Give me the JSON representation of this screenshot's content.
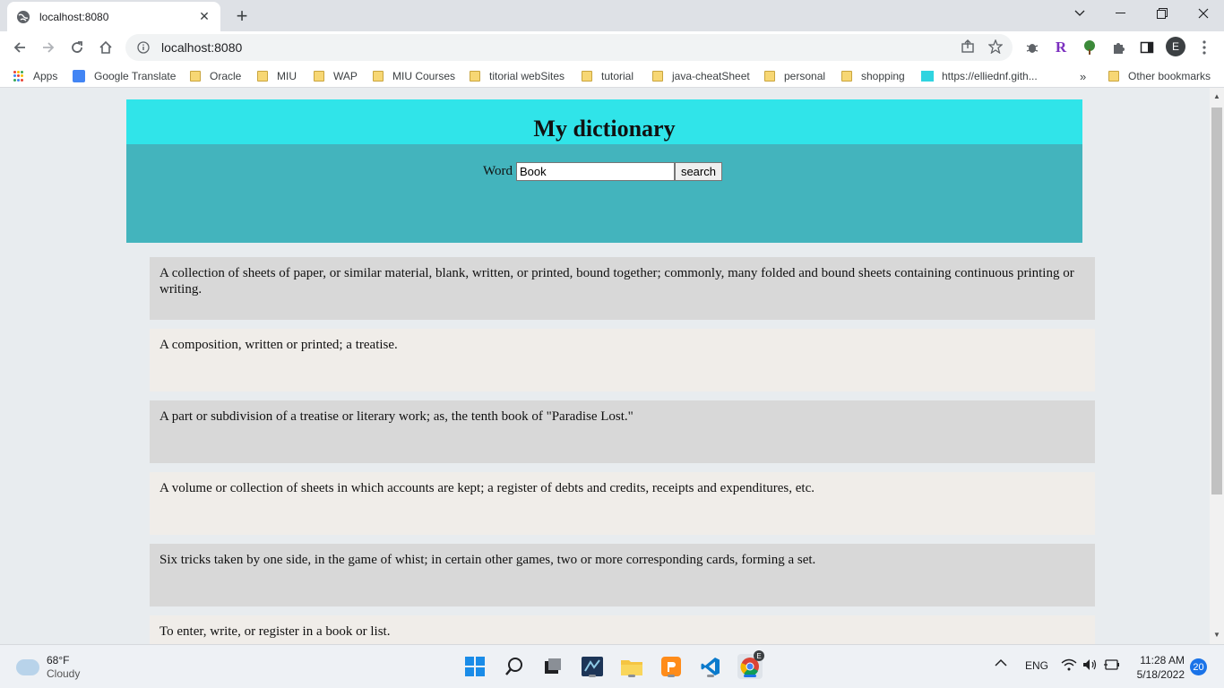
{
  "browser": {
    "tab_title": "localhost:8080",
    "address": "localhost:8080",
    "profile_initial": "E",
    "window_controls": [
      "chevron-down",
      "minimize",
      "restore",
      "close"
    ]
  },
  "bookmarks": [
    {
      "label": "Apps",
      "icon": "apps-grid-icon"
    },
    {
      "label": "Google Translate",
      "icon": "google-translate-icon"
    },
    {
      "label": "Oracle",
      "icon": "folder-icon"
    },
    {
      "label": "MIU",
      "icon": "folder-icon"
    },
    {
      "label": "WAP",
      "icon": "folder-icon"
    },
    {
      "label": "MIU Courses",
      "icon": "folder-icon"
    },
    {
      "label": "titorial webSites",
      "icon": "folder-icon"
    },
    {
      "label": "tutorial",
      "icon": "folder-icon"
    },
    {
      "label": "java-cheatSheet",
      "icon": "folder-icon"
    },
    {
      "label": "personal",
      "icon": "folder-icon"
    },
    {
      "label": "shopping",
      "icon": "folder-icon"
    },
    {
      "label": "https://elliednf.gith...",
      "icon": "site-favicon-icon"
    },
    {
      "label": "»",
      "icon": ""
    },
    {
      "label": "Other bookmarks",
      "icon": "folder-icon"
    }
  ],
  "page": {
    "title": "My dictionary",
    "word_label": "Word",
    "word_value": "Book",
    "search_label": "search",
    "definitions": [
      "A collection of sheets of paper, or similar material, blank, written, or printed, bound together; commonly, many folded and bound sheets containing continuous printing or writing.",
      "A composition, written or printed; a treatise.",
      "A part or subdivision of a treatise or literary work; as, the tenth book of \"Paradise Lost.\"",
      "A volume or collection of sheets in which accounts are kept; a register of debts and credits, receipts and expenditures, etc.",
      "Six tricks taken by one side, in the game of whist; in certain other games, two or more corresponding cards, forming a set.",
      "To enter, write, or register in a book or list."
    ]
  },
  "taskbar": {
    "weather_temp": "68°F",
    "weather_desc": "Cloudy",
    "language": "ENG",
    "time": "11:28 AM",
    "date": "5/18/2022",
    "notifications": "20"
  },
  "colors": {
    "header_top": "#30e4e9",
    "header_form": "#43b4bd",
    "row_odd": "#d8d8d8",
    "row_even": "#f0ede9"
  }
}
